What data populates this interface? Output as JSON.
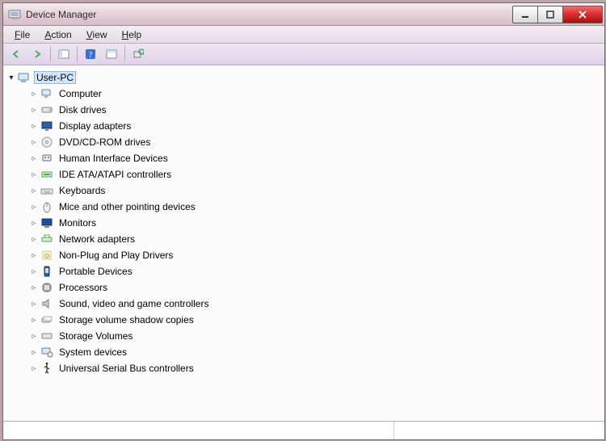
{
  "window": {
    "title": "Device Manager"
  },
  "menu": {
    "file": {
      "label": "File",
      "accel": "F"
    },
    "action": {
      "label": "Action",
      "accel": "A"
    },
    "view": {
      "label": "View",
      "accel": "V"
    },
    "help": {
      "label": "Help",
      "accel": "H"
    }
  },
  "tree": {
    "root": {
      "label": "User-PC",
      "expanded": true
    },
    "items": [
      {
        "label": "Computer",
        "icon": "computer-icon"
      },
      {
        "label": "Disk drives",
        "icon": "disk-icon"
      },
      {
        "label": "Display adapters",
        "icon": "display-icon"
      },
      {
        "label": "DVD/CD-ROM drives",
        "icon": "dvd-icon"
      },
      {
        "label": "Human Interface Devices",
        "icon": "hid-icon"
      },
      {
        "label": "IDE ATA/ATAPI controllers",
        "icon": "ide-icon"
      },
      {
        "label": "Keyboards",
        "icon": "keyboard-icon"
      },
      {
        "label": "Mice and other pointing devices",
        "icon": "mouse-icon"
      },
      {
        "label": "Monitors",
        "icon": "monitor-icon"
      },
      {
        "label": "Network adapters",
        "icon": "network-icon"
      },
      {
        "label": "Non-Plug and Play Drivers",
        "icon": "npnp-icon"
      },
      {
        "label": "Portable Devices",
        "icon": "portable-icon"
      },
      {
        "label": "Processors",
        "icon": "cpu-icon"
      },
      {
        "label": "Sound, video and game controllers",
        "icon": "sound-icon"
      },
      {
        "label": "Storage volume shadow copies",
        "icon": "shadow-icon"
      },
      {
        "label": "Storage Volumes",
        "icon": "volume-icon"
      },
      {
        "label": "System devices",
        "icon": "system-icon"
      },
      {
        "label": "Universal Serial Bus controllers",
        "icon": "usb-icon"
      }
    ]
  }
}
